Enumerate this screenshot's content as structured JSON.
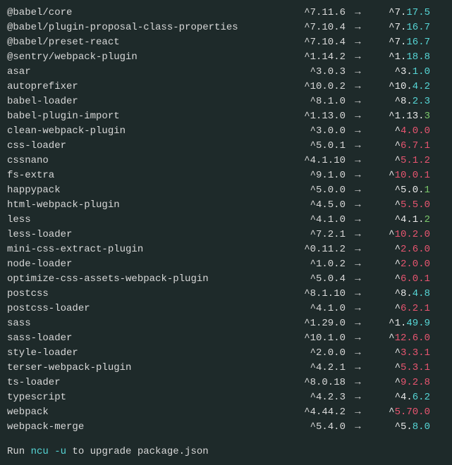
{
  "packages": [
    {
      "name": "@babel/core",
      "current": "^7.11.6",
      "arrow": "→",
      "newPrefix": "^7.",
      "newSuffix": "17.5",
      "type": "cyan"
    },
    {
      "name": "@babel/plugin-proposal-class-properties",
      "current": "^7.10.4",
      "arrow": "→",
      "newPrefix": "^7.",
      "newSuffix": "16.7",
      "type": "cyan"
    },
    {
      "name": "@babel/preset-react",
      "current": "^7.10.4",
      "arrow": "→",
      "newPrefix": "^7.",
      "newSuffix": "16.7",
      "type": "cyan"
    },
    {
      "name": "@sentry/webpack-plugin",
      "current": "^1.14.2",
      "arrow": "→",
      "newPrefix": "^1.",
      "newSuffix": "18.8",
      "type": "cyan"
    },
    {
      "name": "asar",
      "current": "^3.0.3",
      "arrow": "→",
      "newPrefix": "^3.",
      "newSuffix": "1.0",
      "type": "cyan"
    },
    {
      "name": "autoprefixer",
      "current": "^10.0.2",
      "arrow": "→",
      "newPrefix": "^10.",
      "newSuffix": "4.2",
      "type": "cyan"
    },
    {
      "name": "babel-loader",
      "current": "^8.1.0",
      "arrow": "→",
      "newPrefix": "^8.",
      "newSuffix": "2.3",
      "type": "cyan"
    },
    {
      "name": "babel-plugin-import",
      "current": "^1.13.0",
      "arrow": "→",
      "newPrefix": "^1.13.",
      "newSuffix": "3",
      "type": "green"
    },
    {
      "name": "clean-webpack-plugin",
      "current": "^3.0.0",
      "arrow": "→",
      "newPrefix": "^",
      "newSuffix": "4.0.0",
      "type": "red"
    },
    {
      "name": "css-loader",
      "current": "^5.0.1",
      "arrow": "→",
      "newPrefix": "^",
      "newSuffix": "6.7.1",
      "type": "red"
    },
    {
      "name": "cssnano",
      "current": "^4.1.10",
      "arrow": "→",
      "newPrefix": "^",
      "newSuffix": "5.1.2",
      "type": "red"
    },
    {
      "name": "fs-extra",
      "current": "^9.1.0",
      "arrow": "→",
      "newPrefix": "^",
      "newSuffix": "10.0.1",
      "type": "red"
    },
    {
      "name": "happypack",
      "current": "^5.0.0",
      "arrow": "→",
      "newPrefix": "^5.0.",
      "newSuffix": "1",
      "type": "green"
    },
    {
      "name": "html-webpack-plugin",
      "current": "^4.5.0",
      "arrow": "→",
      "newPrefix": "^",
      "newSuffix": "5.5.0",
      "type": "red"
    },
    {
      "name": "less",
      "current": "^4.1.0",
      "arrow": "→",
      "newPrefix": "^4.1.",
      "newSuffix": "2",
      "type": "green"
    },
    {
      "name": "less-loader",
      "current": "^7.2.1",
      "arrow": "→",
      "newPrefix": "^",
      "newSuffix": "10.2.0",
      "type": "red"
    },
    {
      "name": "mini-css-extract-plugin",
      "current": "^0.11.2",
      "arrow": "→",
      "newPrefix": "^",
      "newSuffix": "2.6.0",
      "type": "red"
    },
    {
      "name": "node-loader",
      "current": "^1.0.2",
      "arrow": "→",
      "newPrefix": "^",
      "newSuffix": "2.0.0",
      "type": "red"
    },
    {
      "name": "optimize-css-assets-webpack-plugin",
      "current": "^5.0.4",
      "arrow": "→",
      "newPrefix": "^",
      "newSuffix": "6.0.1",
      "type": "red"
    },
    {
      "name": "postcss",
      "current": "^8.1.10",
      "arrow": "→",
      "newPrefix": "^8.",
      "newSuffix": "4.8",
      "type": "cyan"
    },
    {
      "name": "postcss-loader",
      "current": "^4.1.0",
      "arrow": "→",
      "newPrefix": "^",
      "newSuffix": "6.2.1",
      "type": "red"
    },
    {
      "name": "sass",
      "current": "^1.29.0",
      "arrow": "→",
      "newPrefix": "^1.",
      "newSuffix": "49.9",
      "type": "cyan"
    },
    {
      "name": "sass-loader",
      "current": "^10.1.0",
      "arrow": "→",
      "newPrefix": "^",
      "newSuffix": "12.6.0",
      "type": "red"
    },
    {
      "name": "style-loader",
      "current": "^2.0.0",
      "arrow": "→",
      "newPrefix": "^",
      "newSuffix": "3.3.1",
      "type": "red"
    },
    {
      "name": "terser-webpack-plugin",
      "current": "^4.2.1",
      "arrow": "→",
      "newPrefix": "^",
      "newSuffix": "5.3.1",
      "type": "red"
    },
    {
      "name": "ts-loader",
      "current": "^8.0.18",
      "arrow": "→",
      "newPrefix": "^",
      "newSuffix": "9.2.8",
      "type": "red"
    },
    {
      "name": "typescript",
      "current": "^4.2.3",
      "arrow": "→",
      "newPrefix": "^4.",
      "newSuffix": "6.2",
      "type": "cyan"
    },
    {
      "name": "webpack",
      "current": "^4.44.2",
      "arrow": "→",
      "newPrefix": "^",
      "newSuffix": "5.70.0",
      "type": "red"
    },
    {
      "name": "webpack-merge",
      "current": "^5.4.0",
      "arrow": "→",
      "newPrefix": "^5.",
      "newSuffix": "8.0",
      "type": "cyan"
    }
  ],
  "footer": {
    "pre": "Run ",
    "cmd": "ncu -u",
    "post": " to upgrade package.json"
  }
}
